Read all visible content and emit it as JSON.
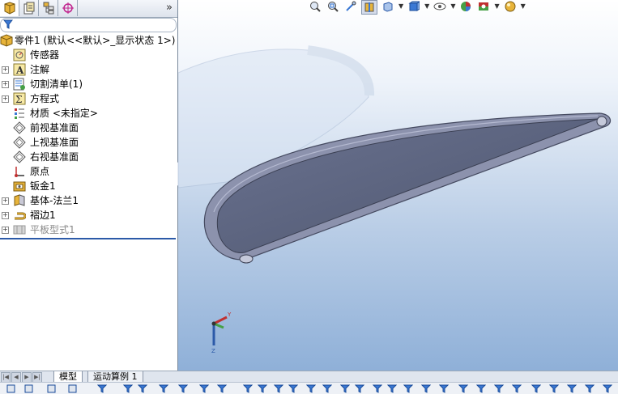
{
  "feature_manager": {
    "tabs": [
      {
        "icon": "feature-manager-icon"
      },
      {
        "icon": "property-manager-icon"
      },
      {
        "icon": "configuration-manager-icon"
      },
      {
        "icon": "dimxpert-manager-icon"
      }
    ],
    "expand_label": "»",
    "filter_icon": "filter-icon",
    "root": {
      "label": "零件1  (默认<<默认>_显示状态 1>)",
      "icon": "part-icon"
    },
    "tree_items": [
      {
        "label": "传感器",
        "icon": "sensor-icon",
        "expandable": false
      },
      {
        "label": "注解",
        "icon": "annotation-icon",
        "expandable": true
      },
      {
        "label": "切割清单(1)",
        "icon": "cut-list-icon",
        "expandable": true
      },
      {
        "label": "方程式",
        "icon": "equation-icon",
        "expandable": true
      },
      {
        "label": "材质 <未指定>",
        "icon": "material-icon",
        "expandable": false
      },
      {
        "label": "前视基准面",
        "icon": "plane-icon",
        "expandable": false
      },
      {
        "label": "上视基准面",
        "icon": "plane-icon",
        "expandable": false
      },
      {
        "label": "右视基准面",
        "icon": "plane-icon",
        "expandable": false
      },
      {
        "label": "原点",
        "icon": "origin-icon",
        "expandable": false
      },
      {
        "label": "钣金1",
        "icon": "sheet-metal-icon",
        "expandable": false
      },
      {
        "label": "基体-法兰1",
        "icon": "base-flange-icon",
        "expandable": true
      },
      {
        "label": "褶边1",
        "icon": "hem-icon",
        "expandable": true
      },
      {
        "label": "平板型式1",
        "icon": "flat-pattern-icon",
        "expandable": true,
        "suppressed": true
      }
    ]
  },
  "heads_up_toolbar": [
    {
      "icon": "zoom-to-fit-icon"
    },
    {
      "icon": "zoom-to-area-icon"
    },
    {
      "icon": "previous-view-icon"
    },
    {
      "icon": "section-view-icon",
      "active": true
    },
    {
      "icon": "view-orientation-icon",
      "dropdown": true
    },
    {
      "icon": "display-style-icon",
      "dropdown": true
    },
    {
      "icon": "hide-show-items-icon",
      "dropdown": true
    },
    {
      "icon": "edit-appearance-icon"
    },
    {
      "icon": "apply-scene-icon",
      "dropdown": true
    },
    {
      "icon": "view-settings-icon",
      "dropdown": true
    }
  ],
  "triad": {
    "x_label": "Y",
    "z_label": "Z"
  },
  "bottom_tabs": [
    {
      "label": "模型",
      "active": true
    },
    {
      "label": "运动算例 1",
      "active": false
    }
  ],
  "colors": {
    "panel_border": "#7a8a9c",
    "rollback_bar": "#2c5aa8",
    "model_face": "#5e6680",
    "model_edge": "#9aa0bb"
  }
}
